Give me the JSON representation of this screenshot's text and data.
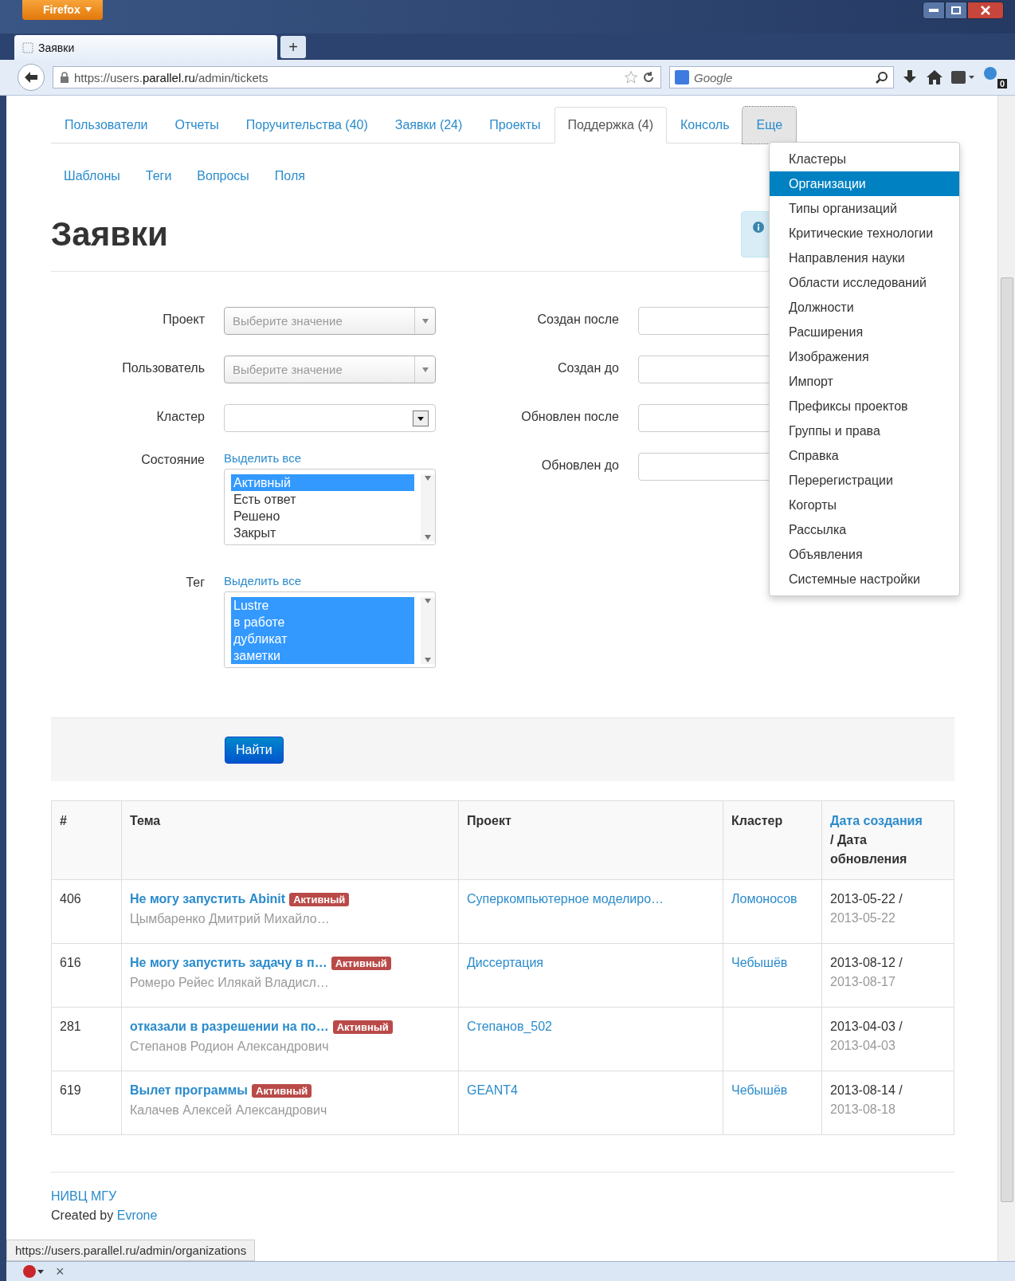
{
  "browser": {
    "app_button": "Firefox",
    "tab_title": "Заявки",
    "new_tab": "+",
    "url": "https://users.**parallel.ru**/admin/tickets",
    "search_placeholder": "Google",
    "addon_badge": "0"
  },
  "nav_tabs": [
    {
      "label": "Пользователи",
      "selected": false,
      "expanded": false
    },
    {
      "label": "Отчеты",
      "selected": false,
      "expanded": false
    },
    {
      "label": "Поручительства (40)",
      "selected": false,
      "expanded": false
    },
    {
      "label": "Заявки (24)",
      "selected": false,
      "expanded": false
    },
    {
      "label": "Проекты",
      "selected": false,
      "expanded": false
    },
    {
      "label": "Поддержка (4)",
      "selected": true,
      "expanded": false
    },
    {
      "label": "Консоль",
      "selected": false,
      "expanded": false
    },
    {
      "label": "Еще",
      "selected": false,
      "expanded": true
    }
  ],
  "dropdown_menu": [
    {
      "label": "Кластеры",
      "selected": false
    },
    {
      "label": "Организации",
      "selected": true
    },
    {
      "label": "Типы организаций",
      "selected": false
    },
    {
      "label": "Критические технологии",
      "selected": false
    },
    {
      "label": "Направления науки",
      "selected": false
    },
    {
      "label": "Области исследований",
      "selected": false
    },
    {
      "label": "Должности",
      "selected": false
    },
    {
      "label": "Расширения",
      "selected": false
    },
    {
      "label": "Изображения",
      "selected": false
    },
    {
      "label": "Импорт",
      "selected": false
    },
    {
      "label": "Префиксы проектов",
      "selected": false
    },
    {
      "label": "Группы и права",
      "selected": false
    },
    {
      "label": "Справка",
      "selected": false
    },
    {
      "label": "Перерегистрации",
      "selected": false
    },
    {
      "label": "Когорты",
      "selected": false
    },
    {
      "label": "Рассылка",
      "selected": false
    },
    {
      "label": "Объявления",
      "selected": false
    },
    {
      "label": "Системные настройки",
      "selected": false
    }
  ],
  "sub_nav": [
    "Шаблоны",
    "Теги",
    "Вопросы",
    "Поля"
  ],
  "page_title": "Заявки",
  "filters_left": [
    {
      "label": "Проект",
      "kind": "select",
      "placeholder": "Выберите значение"
    },
    {
      "label": "Пользователь",
      "kind": "select",
      "placeholder": "Выберите значение"
    },
    {
      "label": "Кластер",
      "kind": "native"
    },
    {
      "label": "Состояние",
      "kind": "listbox",
      "select_all": "Выделить все",
      "options": [
        {
          "label": "Активный",
          "selected": true
        },
        {
          "label": "Есть ответ",
          "selected": false
        },
        {
          "label": "Решено",
          "selected": false
        },
        {
          "label": "Закрыт",
          "selected": false
        }
      ]
    },
    {
      "label": "Тег",
      "kind": "listbox",
      "select_all": "Выделить все",
      "options": [
        {
          "label": "Lustre",
          "selected": true
        },
        {
          "label": "в работе",
          "selected": true
        },
        {
          "label": "дубликат",
          "selected": true
        },
        {
          "label": "заметки",
          "selected": true
        }
      ]
    }
  ],
  "filters_right": [
    {
      "label": "Создан после"
    },
    {
      "label": "Создан до"
    },
    {
      "label": "Обновлен после"
    },
    {
      "label": "Обновлен до"
    }
  ],
  "search_button": "Найти",
  "table": {
    "columns": [
      {
        "label": "#",
        "sortable": false
      },
      {
        "label": "Тема",
        "sortable": false
      },
      {
        "label": "Проект",
        "sortable": false
      },
      {
        "label": "Кластер",
        "sortable": false
      },
      {
        "label": "Дата создания",
        "sortable": true,
        "suffix": "/ Дата обновления"
      }
    ],
    "rows": [
      {
        "id": "406",
        "subject": "Не могу запустить Abinit",
        "status": "Активный",
        "author": "Цымбаренко Дмитрий Михайло…",
        "project": "Суперкомпьютерное моделиро…",
        "cluster": "Ломоносов",
        "created": "2013-05-22 /",
        "updated": "2013-05-22"
      },
      {
        "id": "616",
        "subject": "Не могу запустить задачу в п…",
        "status": "Активный",
        "author": "Ромеро Рейес Илякай Владисл…",
        "project": "Диссертация",
        "cluster": "Чебышёв",
        "created": "2013-08-12 /",
        "updated": "2013-08-17"
      },
      {
        "id": "281",
        "subject": "отказали в разрешении на по…",
        "status": "Активный",
        "author": "Степанов Родион Александрович",
        "project": "Степанов_502",
        "created": "2013-04-03 /",
        "updated": "2013-04-03"
      },
      {
        "id": "619",
        "subject": "Вылет программы",
        "status": "Активный",
        "author": "Калачев Алексей Александрович",
        "project": "GEANT4",
        "cluster": "Чебышёв",
        "created": "2013-08-14 /",
        "updated": "2013-08-18"
      }
    ]
  },
  "footer": {
    "org_link": "НИВЦ МГУ",
    "credit": "Created by",
    "credit_link": "Evrone"
  },
  "status_url": "https://users.parallel.ru/admin/organizations",
  "addon_bar": {
    "close": "×"
  }
}
